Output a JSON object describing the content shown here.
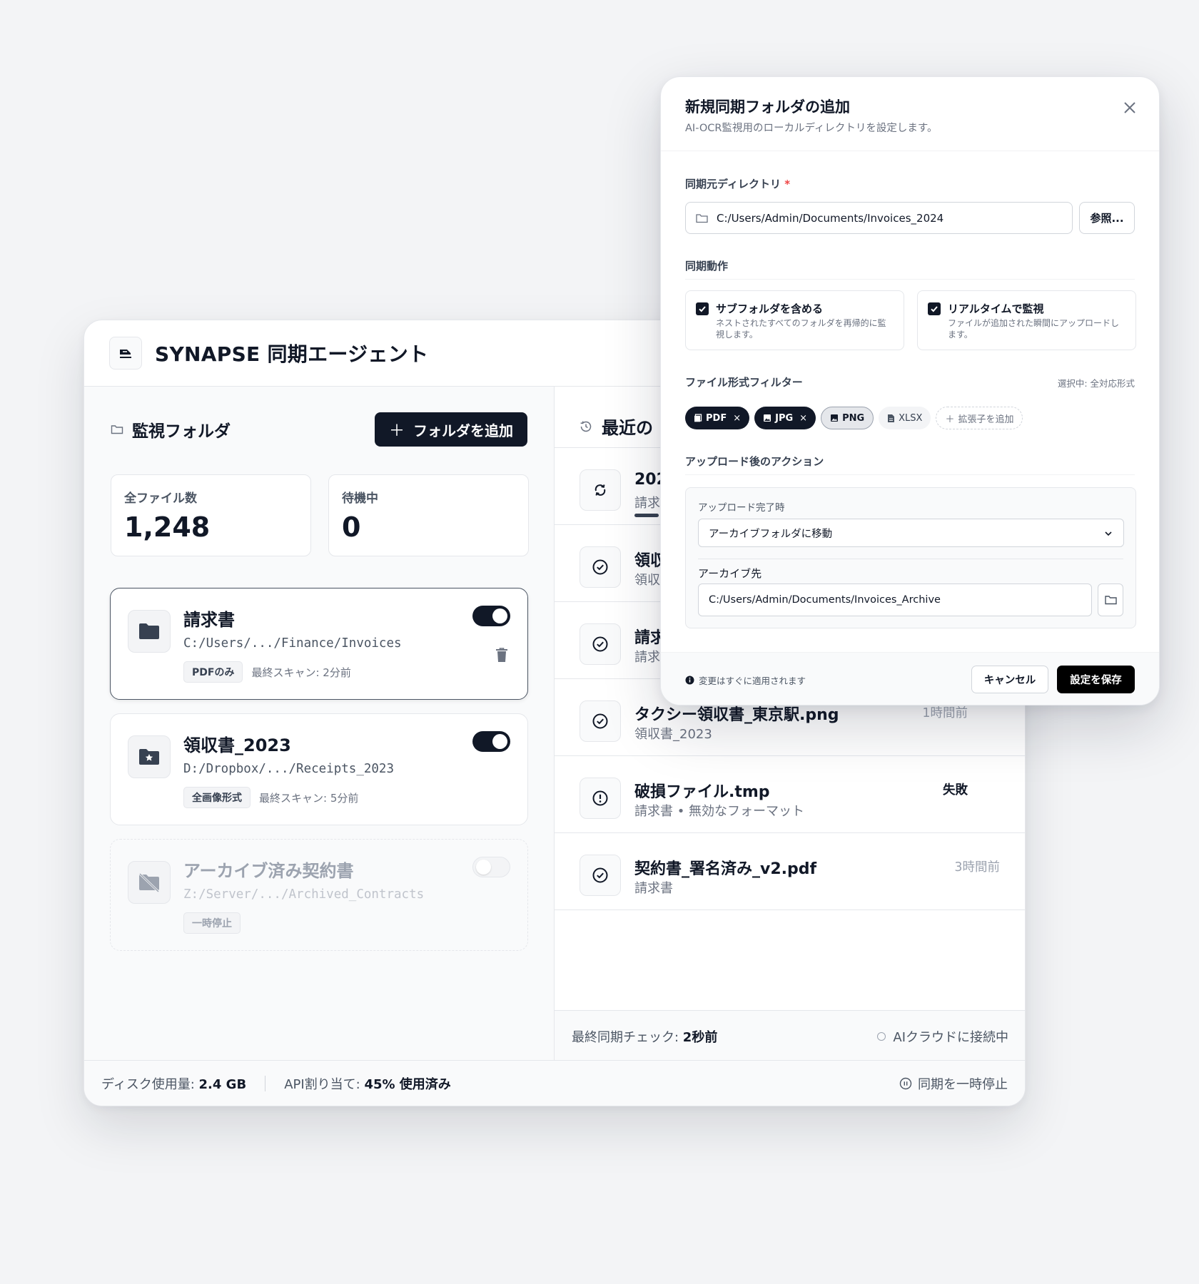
{
  "app": {
    "title": "SYNAPSE 同期エージェント"
  },
  "folders_panel": {
    "title": "監視フォルダ",
    "add_button": "フォルダを追加",
    "stats": [
      {
        "label": "全ファイル数",
        "value": "1,248"
      },
      {
        "label": "待機中",
        "value": "0"
      }
    ],
    "folders": [
      {
        "name": "請求書",
        "path": "C:/Users/.../Finance/Invoices",
        "tag": "PDFのみ",
        "last_scan": "最終スキャン: 2分前",
        "enabled": true,
        "icon": "folder-icon"
      },
      {
        "name": "領収書_2023",
        "path": "D:/Dropbox/.../Receipts_2023",
        "tag": "全画像形式",
        "last_scan": "最終スキャン: 5分前",
        "enabled": true,
        "icon": "folder-star-icon"
      },
      {
        "name": "アーカイブ済み契約書",
        "path": "Z:/Server/.../Archived_Contracts",
        "tag": "一時停止",
        "last_scan": "",
        "enabled": false,
        "icon": "folder-off-icon"
      }
    ]
  },
  "activity": {
    "title": "最近の",
    "items": [
      {
        "title": "202",
        "sub": "請求",
        "time": "",
        "status": "syncing",
        "progress": 0.1
      },
      {
        "title": "領収",
        "sub": "領収",
        "time": "",
        "status": "done"
      },
      {
        "title": "請求",
        "sub": "請求",
        "time": "",
        "status": "done"
      },
      {
        "title": "タクシー領収書_東京駅.png",
        "sub": "領収書_2023",
        "time": "1時間前",
        "status": "done"
      },
      {
        "title": "破損ファイル.tmp",
        "sub": "請求書 • 無効なフォーマット",
        "time": "失敗",
        "status": "failed"
      },
      {
        "title": "契約書_署名済み_v2.pdf",
        "sub": "請求書",
        "time": "3時間前",
        "status": "done"
      }
    ],
    "status_bar": {
      "last_check_label": "最終同期チェック: ",
      "last_check_value": "2秒前",
      "connection": "AIクラウドに接続中"
    }
  },
  "footer": {
    "disk_label": "ディスク使用量: ",
    "disk_value": "2.4 GB",
    "api_label": "API割り当て: ",
    "api_value": "45% 使用済み",
    "pause_label": "同期を一時停止"
  },
  "modal": {
    "title": "新規同期フォルダの追加",
    "subtitle": "AI-OCR監視用のローカルディレクトリを設定します。",
    "source_label": "同期元ディレクトリ",
    "source_required": "*",
    "source_value": "C:/Users/Admin/Documents/Invoices_2024",
    "browse_button": "参照...",
    "sync_section": "同期動作",
    "options": [
      {
        "title": "サブフォルダを含める",
        "desc": "ネストされたすべてのフォルダを再帰的に監視します。",
        "checked": true
      },
      {
        "title": "リアルタイムで監視",
        "desc": "ファイルが追加された瞬間にアップロードします。",
        "checked": true
      }
    ],
    "filter_section": "ファイル形式フィルター",
    "filter_selected": "選択中: 全対応形式",
    "chips": [
      {
        "label": "PDF",
        "style": "dark",
        "removable": true
      },
      {
        "label": "JPG",
        "style": "dark",
        "removable": true
      },
      {
        "label": "PNG",
        "style": "mid",
        "removable": false
      },
      {
        "label": "XLSX",
        "style": "light",
        "removable": false
      }
    ],
    "add_extension": "拡張子を追加",
    "post_upload_section": "アップロード後のアクション",
    "on_complete_label": "アップロード完了時",
    "on_complete_value": "アーカイブフォルダに移動",
    "archive_label": "アーカイブ先",
    "archive_value": "C:/Users/Admin/Documents/Invoices_Archive",
    "footer_note": "変更はすぐに適用されます",
    "cancel_button": "キャンセル",
    "save_button": "設定を保存"
  }
}
